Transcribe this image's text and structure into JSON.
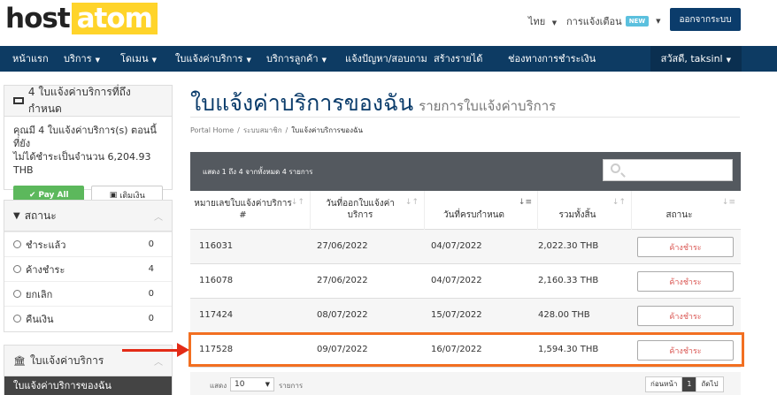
{
  "brand": {
    "host": "host",
    "atom": "atom",
    "accent": "#ffd42a",
    "navy": "#0d3b63"
  },
  "topbar": {
    "language": "ไทย",
    "notifications": "การแจ้งเตือน",
    "new_badge": "NEW",
    "logout": "ออกจากระบบ"
  },
  "nav": {
    "items": [
      {
        "label": "หน้าแรก",
        "dropdown": false
      },
      {
        "label": "บริการ",
        "dropdown": true
      },
      {
        "label": "โดเมน",
        "dropdown": true
      },
      {
        "label": "ใบแจ้งค่าบริการ",
        "dropdown": true
      },
      {
        "label": "บริการลูกค้า",
        "dropdown": true
      },
      {
        "label": "แจ้งปัญหา/สอบถาม",
        "dropdown": false
      },
      {
        "label": "สร้างรายได้",
        "dropdown": false
      },
      {
        "label": "ช่องทางการชำระเงิน",
        "dropdown": false
      }
    ],
    "user": "สวัสดี, taksinl"
  },
  "sidebar": {
    "due_panel": {
      "title": "4 ใบแจ้งค่าบริการที่ถึงกำหนด",
      "line1": "คุณมี 4 ใบแจ้งค่าบริการ(s) ตอนนี้ที่ยัง",
      "line2": "ไม่ได้ชำระเป็นจำนวน 6,204.93 THB",
      "pay_all": "Pay All",
      "add_credit": "เติมเงิน"
    },
    "status_panel": {
      "title": "สถานะ",
      "items": [
        {
          "label": "ชำระแล้ว",
          "count": "0"
        },
        {
          "label": "ค้างชำระ",
          "count": "4"
        },
        {
          "label": "ยกเลิก",
          "count": "0"
        },
        {
          "label": "คืนเงิน",
          "count": "0"
        }
      ]
    },
    "invoice_panel": {
      "title": "ใบแจ้งค่าบริการ",
      "active_item": "ใบแจ้งค่าบริการของฉัน"
    }
  },
  "page": {
    "title": "ใบแจ้งค่าบริการของฉัน",
    "subtitle": "รายการใบแจ้งค่าบริการ",
    "breadcrumb": [
      "Portal Home",
      "ระบบสมาชิก",
      "ใบแจ้งค่าบริการของฉัน"
    ]
  },
  "table": {
    "info": "แสดง 1 ถึง 4 จากทั้งหมด 4 รายการ",
    "columns": [
      {
        "label1": "หมายเลขใบแจ้งค่าบริการ",
        "label2": "#"
      },
      {
        "label1": "วันที่ออกใบแจ้งค่า",
        "label2": "บริการ"
      },
      {
        "label1": "",
        "label2": "วันที่ครบกำหนด"
      },
      {
        "label1": "",
        "label2": "รวมทั้งสิ้น"
      },
      {
        "label1": "",
        "label2": "สถานะ"
      }
    ],
    "rows": [
      {
        "id": "116031",
        "issued": "27/06/2022",
        "due": "04/07/2022",
        "total": "2,022.30 THB",
        "status": "ค้างชำระ"
      },
      {
        "id": "116078",
        "issued": "27/06/2022",
        "due": "04/07/2022",
        "total": "2,160.33 THB",
        "status": "ค้างชำระ"
      },
      {
        "id": "117424",
        "issued": "08/07/2022",
        "due": "15/07/2022",
        "total": "428.00 THB",
        "status": "ค้างชำระ"
      },
      {
        "id": "117528",
        "issued": "09/07/2022",
        "due": "16/07/2022",
        "total": "1,594.30 THB",
        "status": "ค้างชำระ"
      }
    ],
    "footer": {
      "show_label": "แสดง",
      "page_size": "10",
      "records_label": "รายการ",
      "prev": "ก่อนหน้า",
      "current": "1",
      "next": "ถัดไป"
    }
  }
}
